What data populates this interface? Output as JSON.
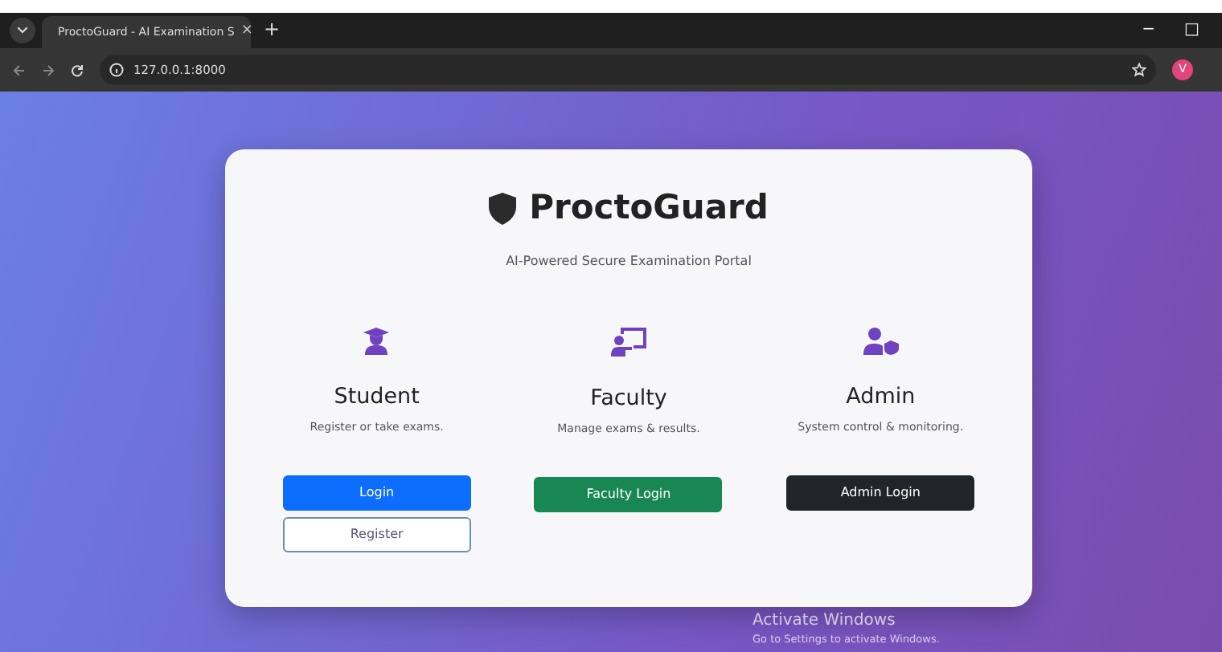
{
  "browser": {
    "tab_title": "ProctoGuard - AI Examination S",
    "tab_close": "×",
    "new_tab": "+",
    "address": "127.0.0.1:8000",
    "profile_initial": "V",
    "window_controls": [
      "−",
      "□"
    ]
  },
  "brand": {
    "name": "ProctoGuard",
    "tagline": "AI-Powered Secure Examination Portal"
  },
  "roles": [
    {
      "kind": "student",
      "title": "Student",
      "description": "Register or take exams.",
      "buttons": [
        {
          "label": "Login"
        },
        {
          "label": "Register"
        }
      ]
    },
    {
      "kind": "faculty",
      "title": "Faculty",
      "description": "Manage exams & results.",
      "buttons": [
        {
          "label": "Faculty Login"
        }
      ]
    },
    {
      "kind": "admin",
      "title": "Admin",
      "description": "System control & monitoring.",
      "buttons": [
        {
          "label": "Admin Login"
        }
      ]
    }
  ],
  "os_notice": {
    "title": "Activate Windows",
    "subtitle": "Go to Settings to activate Windows."
  }
}
